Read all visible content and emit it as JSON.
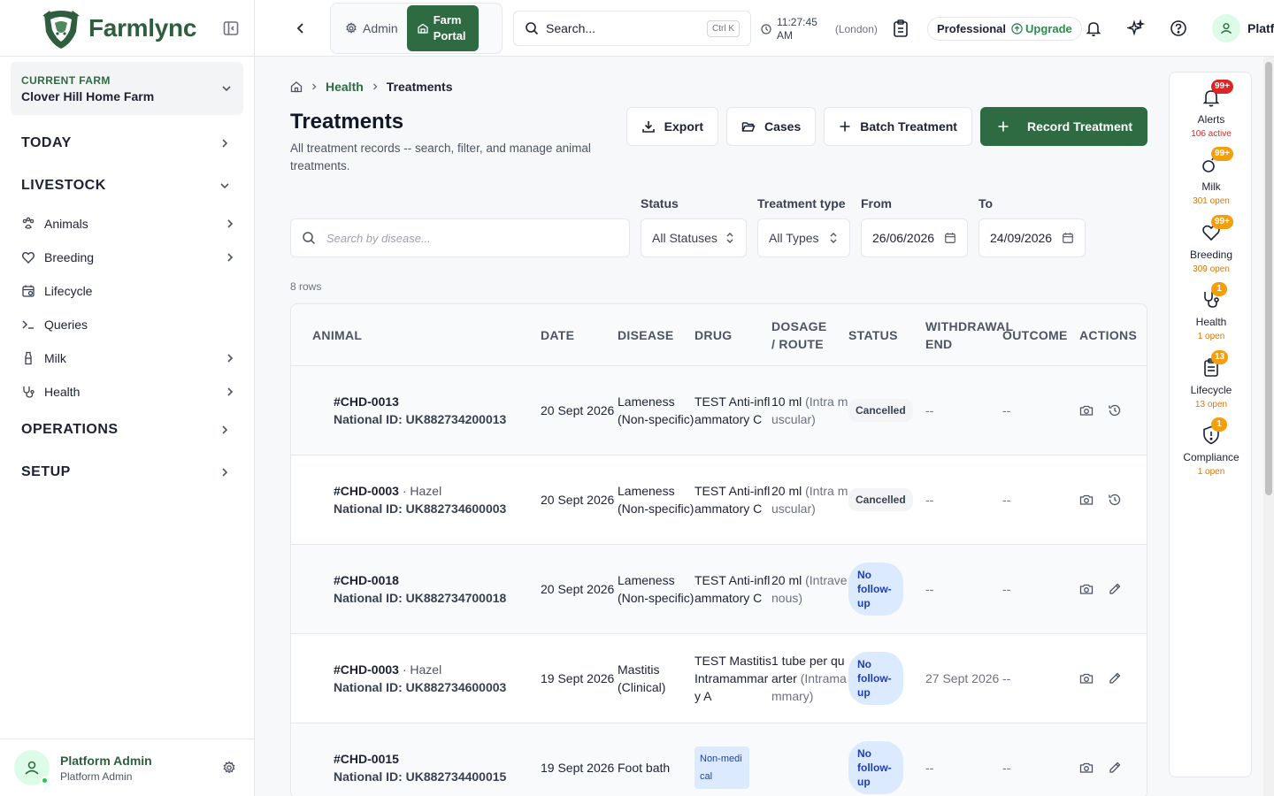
{
  "app": {
    "name": "Farmlync"
  },
  "sidebar": {
    "farm_label": "CURRENT FARM",
    "farm_name": "Clover Hill Home Farm",
    "sections": {
      "today": "TODAY",
      "livestock": "LIVESTOCK",
      "operations": "OPERATIONS",
      "setup": "SETUP"
    },
    "items": [
      {
        "label": "Animals",
        "icon": "paw-icon"
      },
      {
        "label": "Breeding",
        "icon": "heart-icon"
      },
      {
        "label": "Lifecycle",
        "icon": "calendar-icon"
      },
      {
        "label": "Queries",
        "icon": "terminal-icon"
      },
      {
        "label": "Milk",
        "icon": "milk-bottle-icon"
      },
      {
        "label": "Health",
        "icon": "stethoscope-icon"
      }
    ],
    "user_name": "Platform Admin",
    "user_role": "Platform Admin"
  },
  "topbar": {
    "admin_label": "Admin",
    "farm_portal_line1": "Farm",
    "farm_portal_line2": "Portal",
    "search_placeholder": "Search...",
    "search_shortcut": "Ctrl K",
    "time_line1": "11:27:45",
    "time_line2": "AM",
    "timezone": "(London)",
    "plan": "Professional",
    "upgrade": "Upgrade",
    "user_name_partial": "Platf"
  },
  "breadcrumb": {
    "section": "Health",
    "current": "Treatments"
  },
  "page": {
    "title": "Treatments",
    "subtitle": "All treatment records -- search, filter, and manage animal treatments."
  },
  "actions": {
    "export": "Export",
    "cases": "Cases",
    "batch": "Batch Treatment",
    "record": "Record Treatment"
  },
  "filters": {
    "search_placeholder": "Search by disease...",
    "status_label": "Status",
    "status_value": "All Statuses",
    "type_label": "Treatment type",
    "type_value": "All Types",
    "from_label": "From",
    "from_value": "26/06/2026",
    "to_label": "To",
    "to_value": "24/09/2026"
  },
  "rowcount": "8 rows",
  "table": {
    "headers": {
      "animal": "ANIMAL",
      "date": "DATE",
      "disease": "DISEASE",
      "drug": "DRUG",
      "dosage_l1": "DOSAGE",
      "dosage_l2": "/ ROUTE",
      "status": "STATUS",
      "withdrawal_l1": "WITHDRAWAL",
      "withdrawal_l2": "END",
      "outcome": "OUTCOME",
      "actions": "ACTIONS"
    },
    "nat_label": "National ID:",
    "rows": [
      {
        "id": "#CHD-0013",
        "name": "",
        "nat": "UK882734200013",
        "date": "20 Sept 2026",
        "disease": "Lameness (Non-specific)",
        "drug": "TEST Anti-inflammatory C",
        "dose": "10 ml",
        "route": "(Intra muscular)",
        "status": "Cancelled",
        "withdrawal": "--",
        "outcome": "--",
        "second_action": "history"
      },
      {
        "id": "#CHD-0003",
        "name": "Hazel",
        "nat": "UK882734600003",
        "date": "20 Sept 2026",
        "disease": "Lameness (Non-specific)",
        "drug": "TEST Anti-inflammatory C",
        "dose": "20 ml",
        "route": "(Intra muscular)",
        "status": "Cancelled",
        "withdrawal": "--",
        "outcome": "--",
        "second_action": "history"
      },
      {
        "id": "#CHD-0018",
        "name": "",
        "nat": "UK882734700018",
        "date": "20 Sept 2026",
        "disease": "Lameness (Non-specific)",
        "drug": "TEST Anti-inflammatory C",
        "dose": "20 ml",
        "route": "(Intravenous)",
        "status": "No follow-up",
        "withdrawal": "--",
        "outcome": "--",
        "second_action": "edit"
      },
      {
        "id": "#CHD-0003",
        "name": "Hazel",
        "nat": "UK882734600003",
        "date": "19 Sept 2026",
        "disease": "Mastitis (Clinical)",
        "drug": "TEST Mastitis Intramammary A",
        "dose": "1 tube per quarter",
        "route": "(Intramammary)",
        "status": "No follow-up",
        "withdrawal": "27 Sept 2026",
        "outcome": "--",
        "second_action": "edit"
      },
      {
        "id": "#CHD-0015",
        "name": "",
        "nat": "UK882734400015",
        "date": "19 Sept 2026",
        "disease": "Foot bath",
        "drug": "Non-medical",
        "dose": "",
        "route": "",
        "status": "No follow-up",
        "withdrawal": "--",
        "outcome": "--",
        "second_action": "edit"
      }
    ]
  },
  "rail": [
    {
      "label": "Alerts",
      "badge": "99+",
      "count": "106 active",
      "tone": "red"
    },
    {
      "label": "Milk",
      "badge": "99+",
      "count": "301 open",
      "tone": "amber"
    },
    {
      "label": "Breeding",
      "badge": "99+",
      "count": "309 open",
      "tone": "amber"
    },
    {
      "label": "Health",
      "badge": "1",
      "count": "1 open",
      "tone": "amber"
    },
    {
      "label": "Lifecycle",
      "badge": "13",
      "count": "13 open",
      "tone": "amber"
    },
    {
      "label": "Compliance",
      "badge": "1",
      "count": "1 open",
      "tone": "amber"
    }
  ]
}
